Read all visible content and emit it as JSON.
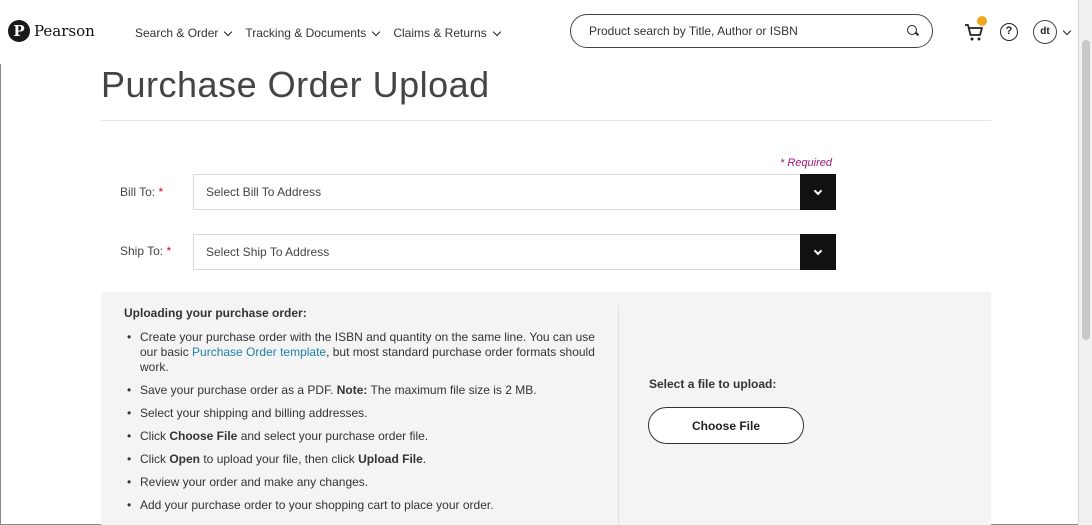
{
  "header": {
    "logo_text": "Pearson",
    "nav": [
      {
        "label": "Search & Order"
      },
      {
        "label": "Tracking & Documents"
      },
      {
        "label": "Claims & Returns"
      }
    ],
    "search_placeholder": "Product search by Title, Author or ISBN",
    "avatar_initials": "dt",
    "help_glyph": "?"
  },
  "page": {
    "title": "Purchase Order Upload",
    "required_note": "* Required",
    "bill_to": {
      "label": "Bill To:",
      "star": "*",
      "placeholder": "Select Bill To Address"
    },
    "ship_to": {
      "label": "Ship To:",
      "star": "*",
      "placeholder": "Select Ship To Address"
    }
  },
  "upload": {
    "instructions_title": "Uploading your purchase order:",
    "step1_a": "Create your purchase order with the ISBN and quantity on the same line. You can use our basic ",
    "step1_link": "Purchase Order template",
    "step1_b": ", but most standard purchase order formats should work.",
    "step2_a": "Save your purchase order as a PDF. ",
    "step2_bold": "Note:",
    "step2_b": " The maximum file size is 2 MB.",
    "step3": "Select your shipping and billing addresses.",
    "step4_a": "Click ",
    "step4_bold": "Choose File",
    "step4_b": " and select your purchase order file.",
    "step5_a": "Click ",
    "step5_bold1": "Open",
    "step5_b": " to upload your file, then click ",
    "step5_bold2": "Upload File",
    "step5_c": ".",
    "step6": "Review your order and make any changes.",
    "step7": "Add your purchase order to your shopping cart to place your order.",
    "select_file_label": "Select a file to upload:",
    "choose_file_label": "Choose File"
  },
  "colors": {
    "required": "#9c1a7a",
    "link": "#1f7fae",
    "cart_badge": "#f0a81f",
    "dropdown_button": "#111111"
  }
}
